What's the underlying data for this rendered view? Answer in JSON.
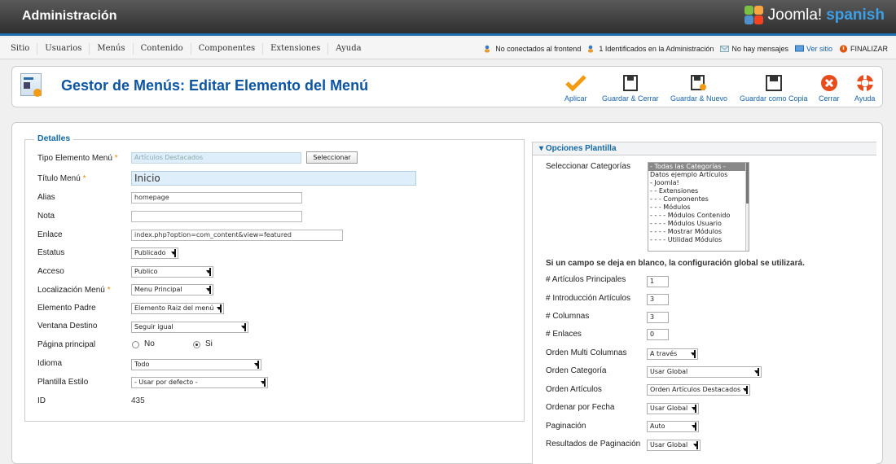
{
  "header": {
    "title": "Administración",
    "logo_text": "Joomla!",
    "logo_sub": "spanish"
  },
  "menubar": {
    "items": [
      "Sitio",
      "Usuarios",
      "Menús",
      "Contenido",
      "Componentes",
      "Extensiones",
      "Ayuda"
    ],
    "status": {
      "frontend": "No conectados al frontend",
      "admin": "1 Identificados en la Administración",
      "messages": "No hay mensajes",
      "view_site": "Ver sitio",
      "logout": "FINALIZAR"
    }
  },
  "toolbar": {
    "title": "Gestor de Menús: Editar Elemento del Menú",
    "buttons": {
      "apply": "Aplicar",
      "save_close": "Guardar & Cerrar",
      "save_new": "Guardar & Nuevo",
      "save_copy": "Guardar como Copia",
      "close": "Cerrar",
      "help": "Ayuda"
    }
  },
  "details": {
    "legend": "Detalles",
    "type_label": "Tipo Elemento Menú",
    "type_value": "Artículos Destacados",
    "select_button": "Seleccionar",
    "title_label": "Título Menú",
    "title_value": "Inicio",
    "alias_label": "Alias",
    "alias_value": "homepage",
    "note_label": "Nota",
    "note_value": "",
    "link_label": "Enlace",
    "link_value": "index.php?option=com_content&view=featured",
    "status_label": "Estatus",
    "status_value": "Publicado",
    "access_label": "Acceso",
    "access_value": "Publico",
    "location_label": "Localización Menú",
    "location_value": "Menu Principal",
    "parent_label": "Elemento Padre",
    "parent_value": "Elemento Raiz del menú",
    "window_label": "Ventana Destino",
    "window_value": "Seguir igual",
    "home_label": "Página principal",
    "home_no": "No",
    "home_yes": "Si",
    "lang_label": "Idioma",
    "lang_value": "Todo",
    "style_label": "Plantilla Estilo",
    "style_value": "- Usar por defecto -",
    "id_label": "ID",
    "id_value": "435",
    "required_mark": "*"
  },
  "options": {
    "heading": "Opciones Plantilla",
    "cat_label": "Seleccionar Categorías",
    "categories": [
      "- Todas las Categorías -",
      "Datos ejemplo Artículos",
      "- Joomla!",
      "- - Extensiones",
      "- - - Componentes",
      "- - - Módulos",
      "- - - - Módulos Contenido",
      "- - - - Módulos Usuario",
      "- - - - Mostrar Módulos",
      "- - - - Utilidad Módulos"
    ],
    "note": "Si un campo se deja en blanco, la configuración global se utilizará.",
    "leading_label": "# Artículos Principales",
    "leading_value": "1",
    "intro_label": "# Introducción Artículos",
    "intro_value": "3",
    "columns_label": "# Columnas",
    "columns_value": "3",
    "links_label": "# Enlaces",
    "links_value": "0",
    "multi_label": "Orden Multi Columnas",
    "multi_value": "A través",
    "cat_order_label": "Orden Categoría",
    "cat_order_value": "Usar Global",
    "art_order_label": "Orden Artículos",
    "art_order_value": "Orden Artículos Destacados",
    "date_label": "Ordenar por Fecha",
    "date_value": "Usar Global",
    "pag_label": "Paginación",
    "pag_value": "Auto",
    "pag_res_label": "Resultados de Paginación",
    "pag_res_value": "Usar Global"
  }
}
